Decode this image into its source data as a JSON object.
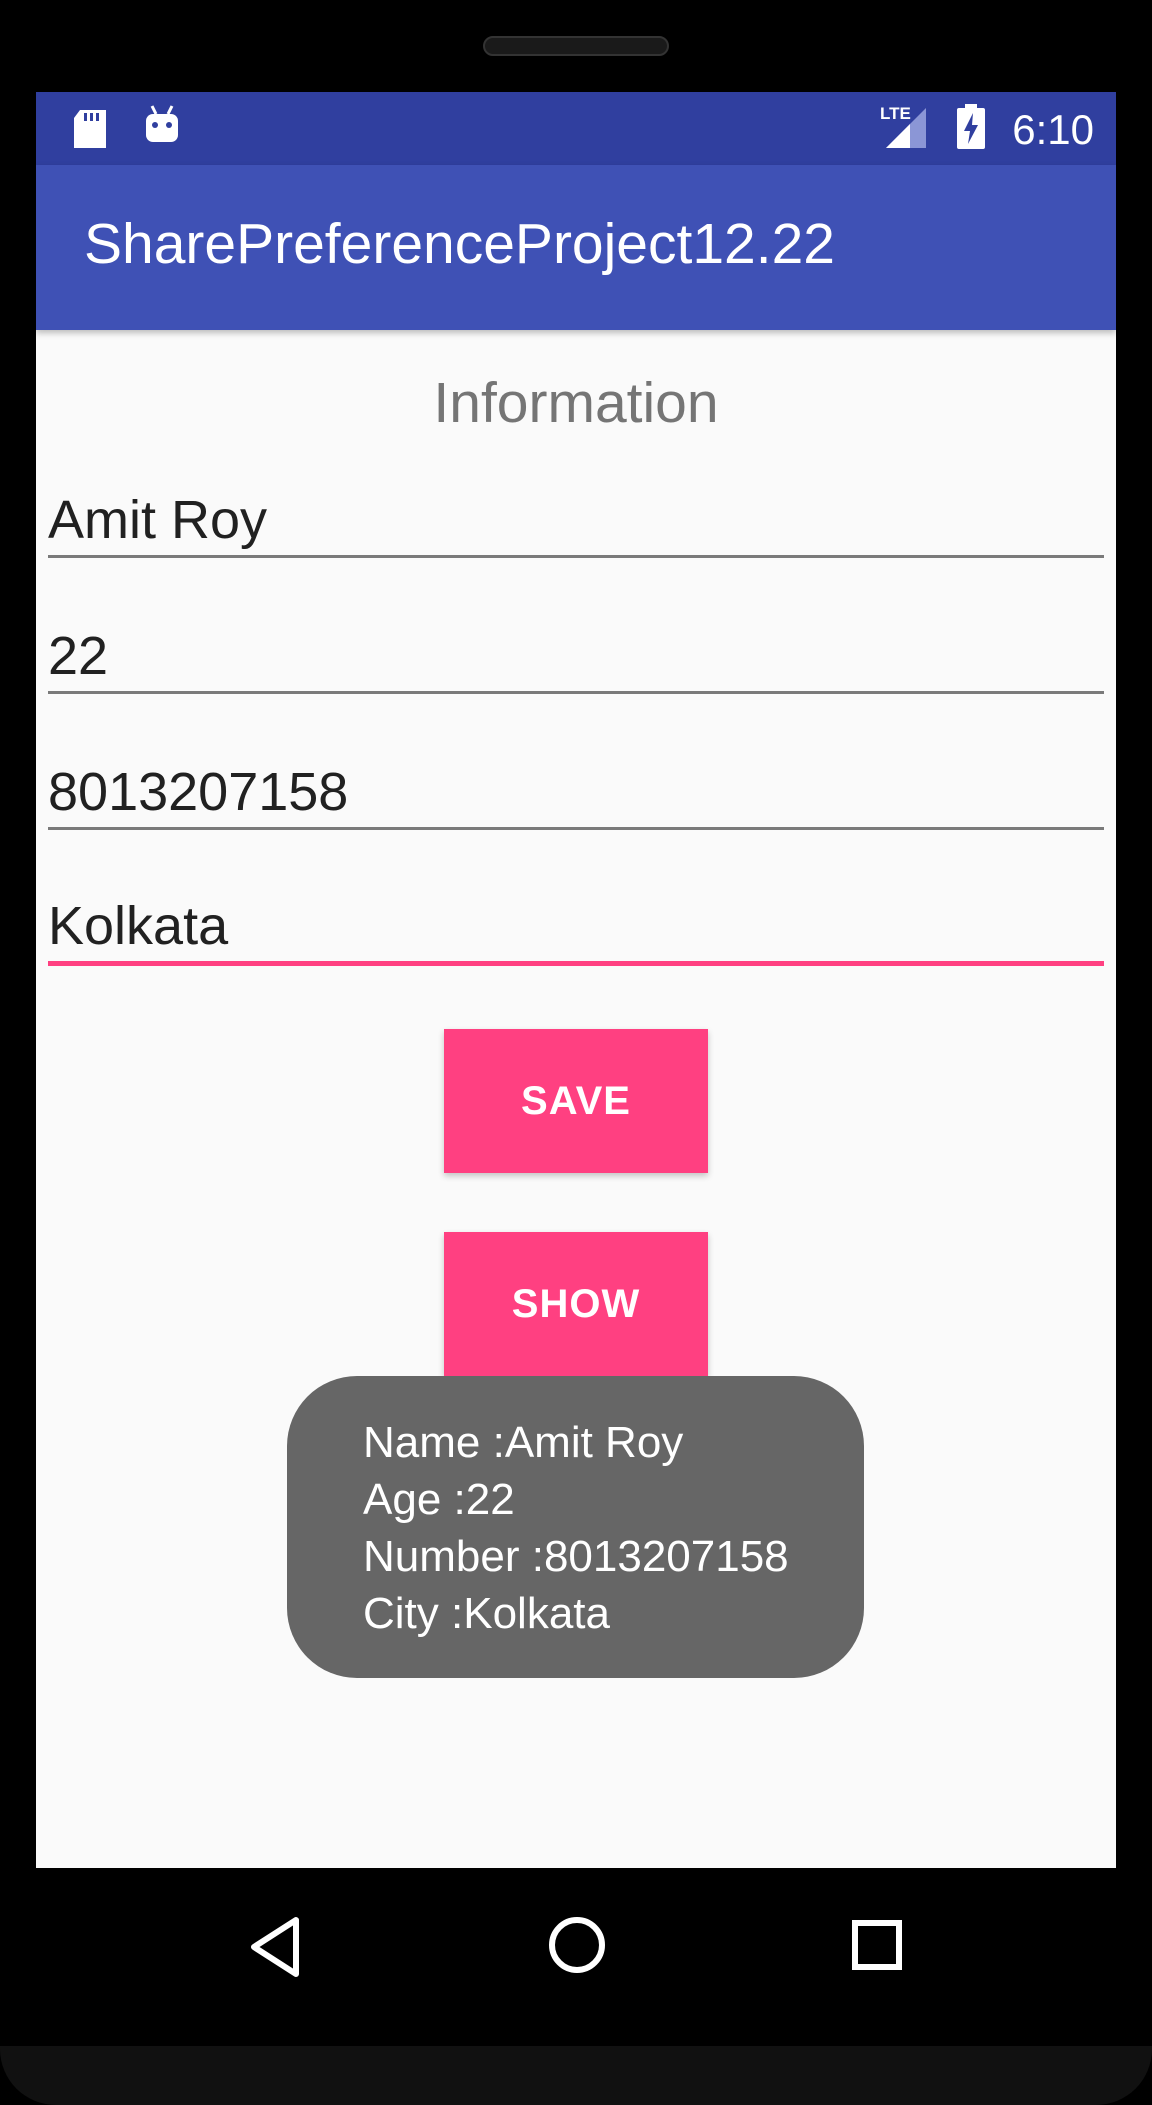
{
  "status_bar": {
    "time": "6:10",
    "network_label": "LTE",
    "icons": [
      "sd-card-icon",
      "android-icon",
      "lte-signal-icon",
      "battery-charging-icon"
    ]
  },
  "app_bar": {
    "title": "SharePreferenceProject12.22"
  },
  "form": {
    "heading": "Information",
    "name_value": "Amit Roy",
    "age_value": "22",
    "number_value": "8013207158",
    "city_value": "Kolkata"
  },
  "buttons": {
    "save_label": "SAVE",
    "show_label": "SHOW"
  },
  "toast": {
    "lines": [
      "Name :Amit Roy",
      "Age :22",
      "Number :8013207158",
      "City :Kolkata"
    ]
  },
  "nav_bar": {
    "icons": [
      "back-icon",
      "home-icon",
      "recents-icon"
    ]
  },
  "colors": {
    "primary": "#3f51b5",
    "primary_dark": "#303f9f",
    "accent": "#ff4081",
    "toast_bg": "#666666"
  }
}
